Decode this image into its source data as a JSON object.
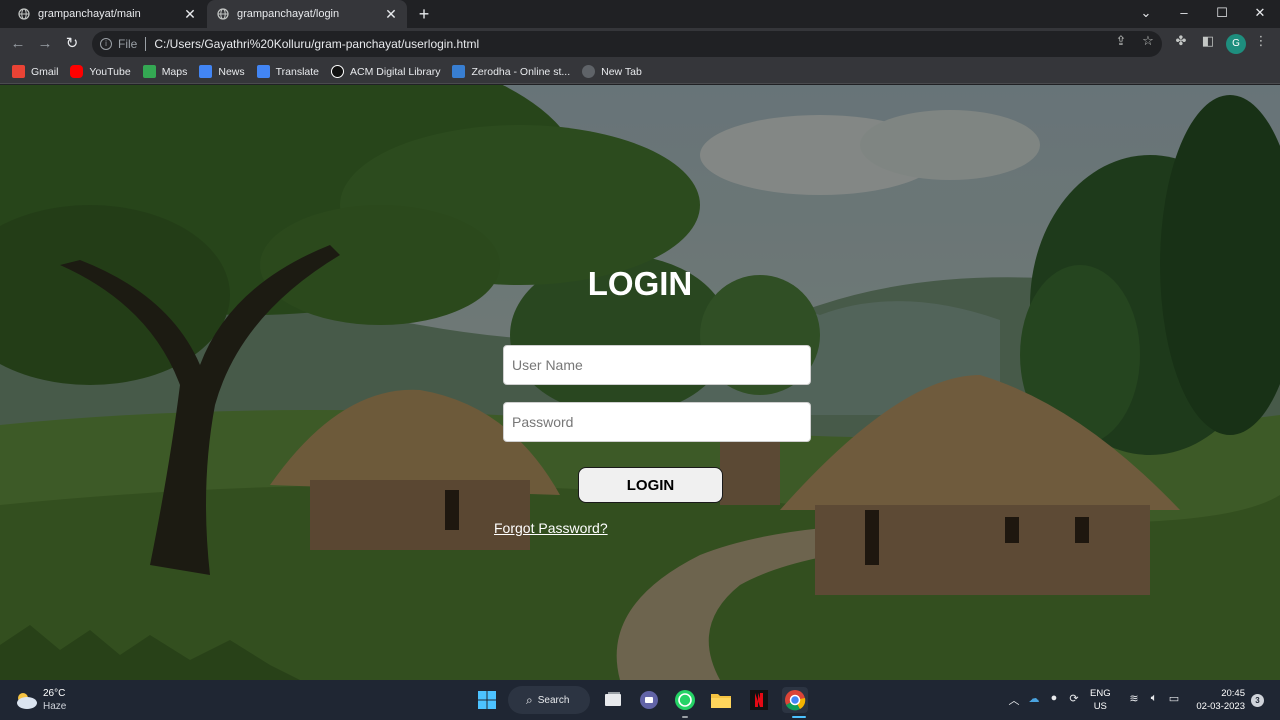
{
  "tabs": [
    {
      "title": "grampanchayat/main"
    },
    {
      "title": "grampanchayat/login"
    }
  ],
  "toolbar": {
    "scheme": "File",
    "url": "C:/Users/Gayathri%20Kolluru/gram-panchayat/userlogin.html",
    "profile_initial": "G"
  },
  "bookmarks": [
    {
      "label": "Gmail",
      "color": "#ea4335"
    },
    {
      "label": "YouTube",
      "color": "#ff0000"
    },
    {
      "label": "Maps",
      "color": "#34a853"
    },
    {
      "label": "News",
      "color": "#4285f4"
    },
    {
      "label": "Translate",
      "color": "#4285f4"
    },
    {
      "label": "ACM Digital Library",
      "color": "#ffffff"
    },
    {
      "label": "Zerodha - Online st...",
      "color": "#387ed1"
    },
    {
      "label": "New Tab",
      "color": "#9aa0a6"
    }
  ],
  "login": {
    "title": "LOGIN",
    "username_placeholder": "User Name",
    "password_placeholder": "Password",
    "button_label": "LOGIN",
    "forgot_label": "Forgot Password?"
  },
  "taskbar": {
    "temperature": "26°C",
    "condition": "Haze",
    "search_label": "Search",
    "lang_line1": "ENG",
    "lang_line2": "US",
    "time": "20:45",
    "date": "02-03-2023",
    "notification_count": "3"
  }
}
